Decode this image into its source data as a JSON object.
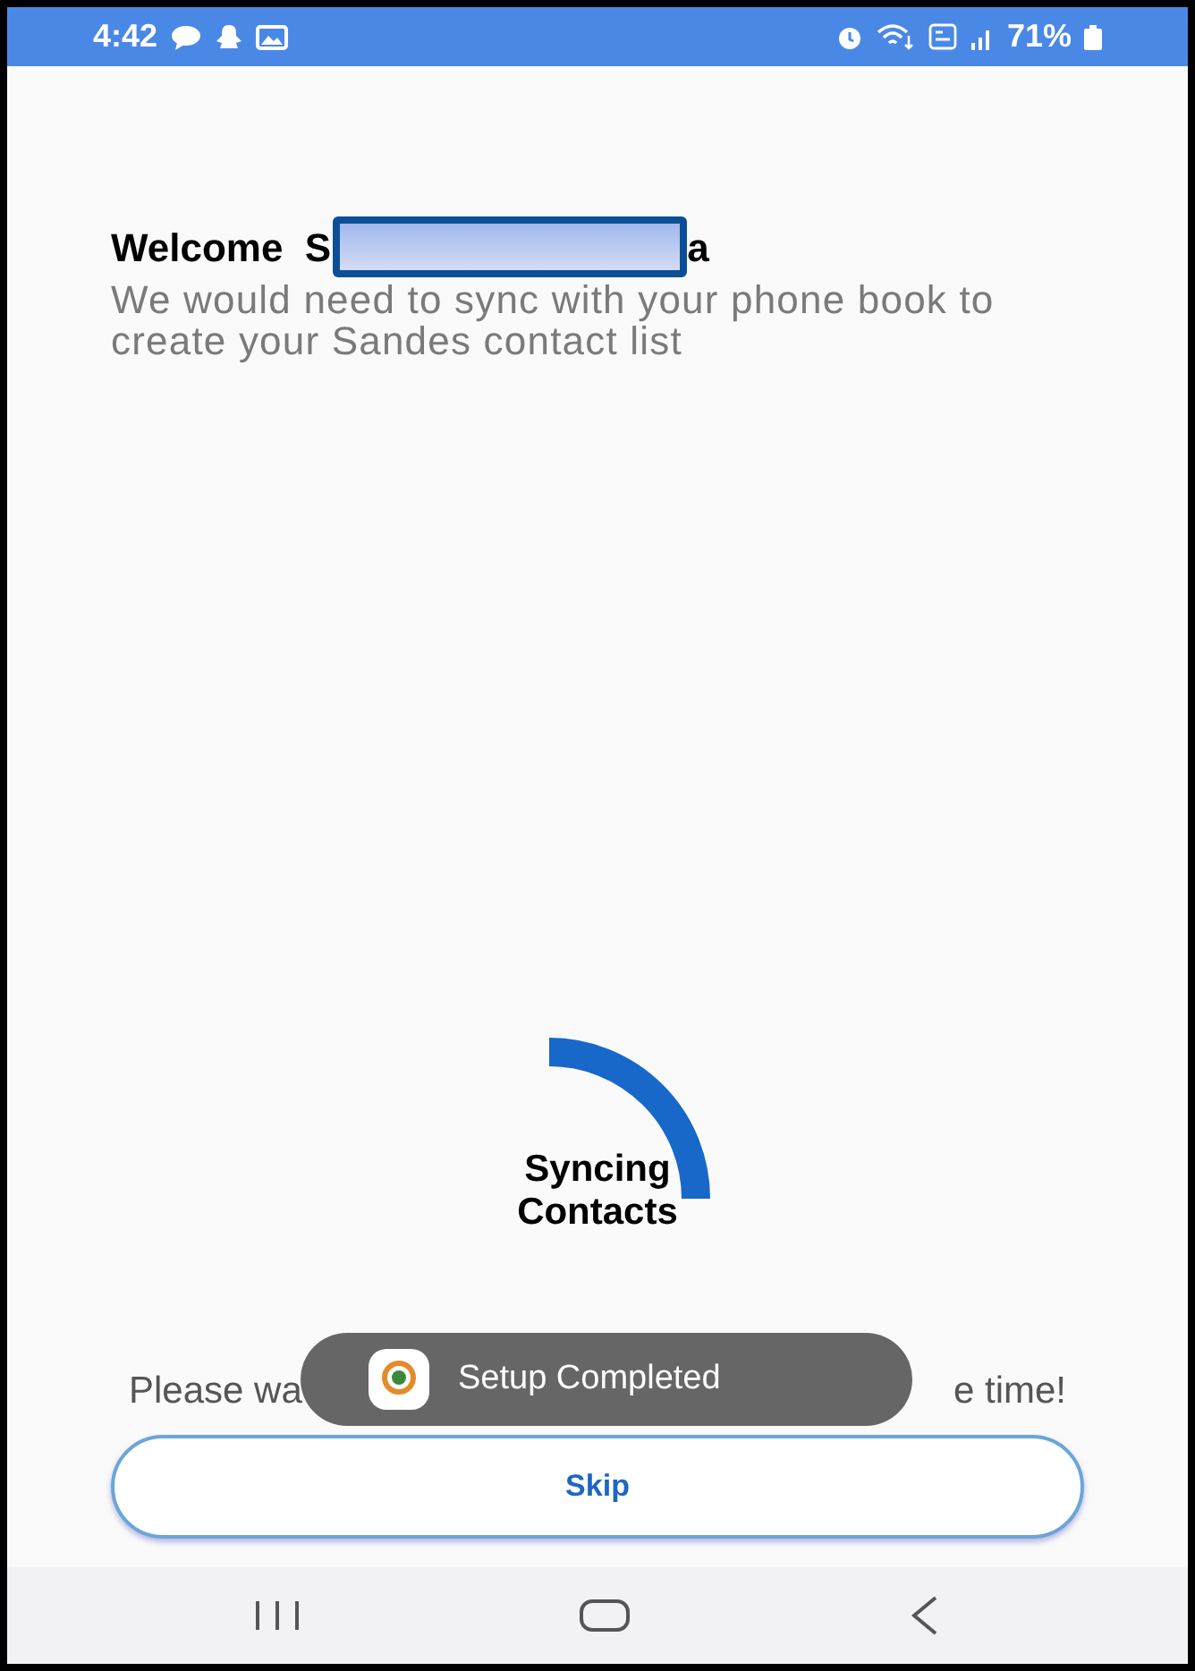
{
  "status_bar": {
    "time": "4:42",
    "battery": "71%"
  },
  "welcome": {
    "greeting": "Welcome  S",
    "name_end": "a"
  },
  "message": "We would need to sync with your phone book to create your Sandes contact list",
  "progress": {
    "label_line_1": "Syncing",
    "label_line_2": "Contacts"
  },
  "hint": {
    "start": "Please wa",
    "end": "e time!"
  },
  "toast": {
    "text": "Setup Completed"
  },
  "skip_button": {
    "label": "Skip"
  }
}
